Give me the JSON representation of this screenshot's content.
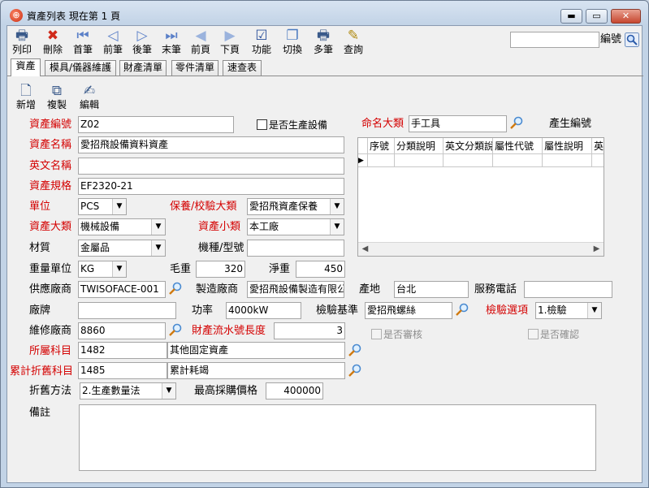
{
  "window": {
    "title": "資產列表 現在第 1 頁",
    "min_label": "▬",
    "max_label": "▭",
    "close_label": "✕"
  },
  "toolbar": [
    {
      "label": "列印",
      "icon": "printer-icon",
      "glyph": "🖶"
    },
    {
      "label": "刪除",
      "icon": "delete-icon",
      "glyph": "✖"
    },
    {
      "label": "首筆",
      "icon": "first-record-icon",
      "glyph": "⏮"
    },
    {
      "label": "前筆",
      "icon": "prev-record-icon",
      "glyph": "◁"
    },
    {
      "label": "後筆",
      "icon": "next-record-icon",
      "glyph": "▷"
    },
    {
      "label": "末筆",
      "icon": "last-record-icon",
      "glyph": "⏭"
    },
    {
      "label": "前頁",
      "icon": "prev-page-icon",
      "glyph": "◀"
    },
    {
      "label": "下頁",
      "icon": "next-page-icon",
      "glyph": "▶"
    },
    {
      "label": "功能",
      "icon": "function-icon",
      "glyph": "☑"
    },
    {
      "label": "切換",
      "icon": "switch-icon",
      "glyph": "❐"
    },
    {
      "label": "多筆",
      "icon": "multi-record-icon",
      "glyph": "🖶"
    },
    {
      "label": "查詢",
      "icon": "query-icon",
      "glyph": "✎"
    }
  ],
  "search": {
    "label": "編號",
    "value": ""
  },
  "tabs": [
    "資產",
    "模具/儀器維護",
    "財產清單",
    "零件清單",
    "速查表"
  ],
  "edit_toolbar": [
    {
      "label": "新增",
      "icon": "new-document-icon",
      "glyph": "🗋"
    },
    {
      "label": "複製",
      "icon": "copy-icon",
      "glyph": "⧉"
    },
    {
      "label": "編輯",
      "icon": "edit-icon",
      "glyph": "✍"
    }
  ],
  "form": {
    "asset_no": {
      "label": "資產編號",
      "value": "Z02"
    },
    "is_production": {
      "label": "是否生產設備"
    },
    "naming_category": {
      "label": "命名大類",
      "value": "手工具"
    },
    "product_code_label": "產生編號",
    "asset_name": {
      "label": "資產名稱",
      "value": "愛招飛設備資料資產"
    },
    "english_name": {
      "label": "英文名稱",
      "value": ""
    },
    "asset_spec": {
      "label": "資產規格",
      "value": "EF2320-21"
    },
    "unit": {
      "label": "單位",
      "value": "PCS"
    },
    "maintenance_category": {
      "label": "保養/校驗大類",
      "value": "愛招飛資產保養"
    },
    "asset_major": {
      "label": "資產大類",
      "value": "機械設備"
    },
    "asset_minor": {
      "label": "資產小類",
      "value": "本工廠"
    },
    "material": {
      "label": "材質",
      "value": "金屬品"
    },
    "model": {
      "label": "機種/型號",
      "value": ""
    },
    "weight_unit": {
      "label": "重量單位",
      "value": "KG"
    },
    "gross_weight": {
      "label": "毛重",
      "value": "320"
    },
    "net_weight": {
      "label": "淨重",
      "value": "450"
    },
    "supplier": {
      "label": "供應廠商",
      "value": "TWISOFACE-001"
    },
    "manufacturer": {
      "label": "製造廠商",
      "value": "愛招飛設備製造有限公"
    },
    "origin": {
      "label": "產地",
      "value": "台北"
    },
    "service_phone": {
      "label": "服務電話",
      "value": ""
    },
    "brand": {
      "label": "廠牌",
      "value": ""
    },
    "power": {
      "label": "功率",
      "value": "4000kW"
    },
    "inspection_standard": {
      "label": "檢驗基準",
      "value": "愛招飛螺絲"
    },
    "inspection_option": {
      "label": "檢驗選項",
      "value": "1.檢驗"
    },
    "repair_vendor": {
      "label": "維修廠商",
      "value": "8860"
    },
    "serial_length": {
      "label": "財產流水號長度",
      "value": "3"
    },
    "is_reviewed": {
      "label": "是否審核"
    },
    "is_confirmed": {
      "label": "是否確認"
    },
    "account_subject": {
      "label": "所屬科目",
      "code": "1482",
      "name": "其他固定資產"
    },
    "depreciation_subject": {
      "label": "累計折舊科目",
      "code": "1485",
      "name": "累計耗竭"
    },
    "depreciation_method": {
      "label": "折舊方法",
      "value": "2.生產數量法"
    },
    "max_price": {
      "label": "最高採購價格",
      "value": "400000"
    },
    "remarks": {
      "label": "備註",
      "value": ""
    }
  },
  "grid": {
    "columns": [
      "序號",
      "分類說明",
      "英文分類說",
      "屬性代號",
      "屬性說明",
      "英"
    ],
    "row_marker": "▶"
  }
}
